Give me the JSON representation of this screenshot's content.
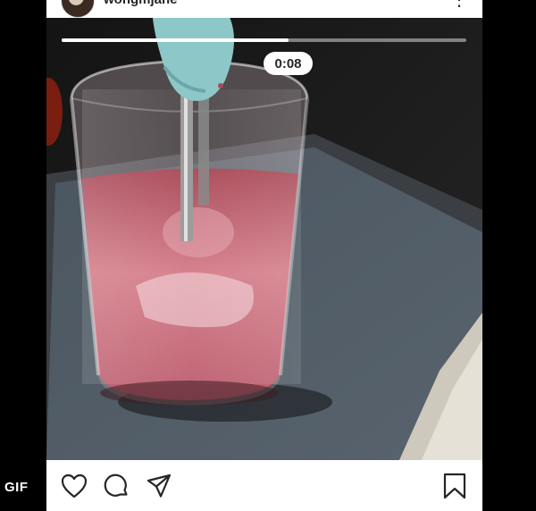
{
  "post": {
    "username": "wongmjane",
    "more_icon": "more-vertical-icon",
    "video": {
      "elapsed_time": "0:08",
      "progress_fraction": 0.56
    },
    "actions": {
      "icons": [
        "heart-icon",
        "comment-icon",
        "share-icon",
        "bookmark-icon"
      ]
    }
  },
  "overlay": {
    "gif_badge": "GIF"
  },
  "colors": {
    "background": "#000000",
    "card": "#ffffff",
    "icon_stroke": "#262626",
    "smoothie": "#c86a78",
    "blender": "#8ec7c7"
  }
}
